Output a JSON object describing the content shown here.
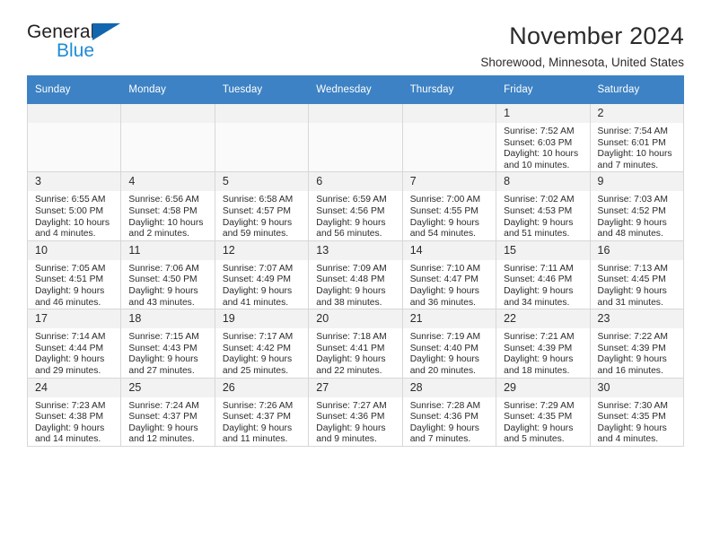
{
  "logo": {
    "word_top": "General",
    "word_bottom": "Blue",
    "triangle_color": "#1266ae",
    "blue_color": "#1f8bd6"
  },
  "header": {
    "title": "November 2024",
    "subtitle": "Shorewood, Minnesota, United States"
  },
  "theme": {
    "header_bg": "#3d82c4",
    "daynum_bg": "#f2f2f2",
    "grid_border": "#d7d7d7",
    "empty_cell_bg": "#fafafa"
  },
  "weekdays": [
    "Sunday",
    "Monday",
    "Tuesday",
    "Wednesday",
    "Thursday",
    "Friday",
    "Saturday"
  ],
  "labels": {
    "sunrise": "Sunrise:",
    "sunset": "Sunset:",
    "daylight": "Daylight:"
  },
  "weeks": [
    [
      {
        "day": "",
        "empty": true
      },
      {
        "day": "",
        "empty": true
      },
      {
        "day": "",
        "empty": true
      },
      {
        "day": "",
        "empty": true
      },
      {
        "day": "",
        "empty": true
      },
      {
        "day": "1",
        "sunrise": "Sunrise: 7:52 AM",
        "sunset": "Sunset: 6:03 PM",
        "daylight": "Daylight: 10 hours and 10 minutes."
      },
      {
        "day": "2",
        "sunrise": "Sunrise: 7:54 AM",
        "sunset": "Sunset: 6:01 PM",
        "daylight": "Daylight: 10 hours and 7 minutes."
      }
    ],
    [
      {
        "day": "3",
        "sunrise": "Sunrise: 6:55 AM",
        "sunset": "Sunset: 5:00 PM",
        "daylight": "Daylight: 10 hours and 4 minutes."
      },
      {
        "day": "4",
        "sunrise": "Sunrise: 6:56 AM",
        "sunset": "Sunset: 4:58 PM",
        "daylight": "Daylight: 10 hours and 2 minutes."
      },
      {
        "day": "5",
        "sunrise": "Sunrise: 6:58 AM",
        "sunset": "Sunset: 4:57 PM",
        "daylight": "Daylight: 9 hours and 59 minutes."
      },
      {
        "day": "6",
        "sunrise": "Sunrise: 6:59 AM",
        "sunset": "Sunset: 4:56 PM",
        "daylight": "Daylight: 9 hours and 56 minutes."
      },
      {
        "day": "7",
        "sunrise": "Sunrise: 7:00 AM",
        "sunset": "Sunset: 4:55 PM",
        "daylight": "Daylight: 9 hours and 54 minutes."
      },
      {
        "day": "8",
        "sunrise": "Sunrise: 7:02 AM",
        "sunset": "Sunset: 4:53 PM",
        "daylight": "Daylight: 9 hours and 51 minutes."
      },
      {
        "day": "9",
        "sunrise": "Sunrise: 7:03 AM",
        "sunset": "Sunset: 4:52 PM",
        "daylight": "Daylight: 9 hours and 48 minutes."
      }
    ],
    [
      {
        "day": "10",
        "sunrise": "Sunrise: 7:05 AM",
        "sunset": "Sunset: 4:51 PM",
        "daylight": "Daylight: 9 hours and 46 minutes."
      },
      {
        "day": "11",
        "sunrise": "Sunrise: 7:06 AM",
        "sunset": "Sunset: 4:50 PM",
        "daylight": "Daylight: 9 hours and 43 minutes."
      },
      {
        "day": "12",
        "sunrise": "Sunrise: 7:07 AM",
        "sunset": "Sunset: 4:49 PM",
        "daylight": "Daylight: 9 hours and 41 minutes."
      },
      {
        "day": "13",
        "sunrise": "Sunrise: 7:09 AM",
        "sunset": "Sunset: 4:48 PM",
        "daylight": "Daylight: 9 hours and 38 minutes."
      },
      {
        "day": "14",
        "sunrise": "Sunrise: 7:10 AM",
        "sunset": "Sunset: 4:47 PM",
        "daylight": "Daylight: 9 hours and 36 minutes."
      },
      {
        "day": "15",
        "sunrise": "Sunrise: 7:11 AM",
        "sunset": "Sunset: 4:46 PM",
        "daylight": "Daylight: 9 hours and 34 minutes."
      },
      {
        "day": "16",
        "sunrise": "Sunrise: 7:13 AM",
        "sunset": "Sunset: 4:45 PM",
        "daylight": "Daylight: 9 hours and 31 minutes."
      }
    ],
    [
      {
        "day": "17",
        "sunrise": "Sunrise: 7:14 AM",
        "sunset": "Sunset: 4:44 PM",
        "daylight": "Daylight: 9 hours and 29 minutes."
      },
      {
        "day": "18",
        "sunrise": "Sunrise: 7:15 AM",
        "sunset": "Sunset: 4:43 PM",
        "daylight": "Daylight: 9 hours and 27 minutes."
      },
      {
        "day": "19",
        "sunrise": "Sunrise: 7:17 AM",
        "sunset": "Sunset: 4:42 PM",
        "daylight": "Daylight: 9 hours and 25 minutes."
      },
      {
        "day": "20",
        "sunrise": "Sunrise: 7:18 AM",
        "sunset": "Sunset: 4:41 PM",
        "daylight": "Daylight: 9 hours and 22 minutes."
      },
      {
        "day": "21",
        "sunrise": "Sunrise: 7:19 AM",
        "sunset": "Sunset: 4:40 PM",
        "daylight": "Daylight: 9 hours and 20 minutes."
      },
      {
        "day": "22",
        "sunrise": "Sunrise: 7:21 AM",
        "sunset": "Sunset: 4:39 PM",
        "daylight": "Daylight: 9 hours and 18 minutes."
      },
      {
        "day": "23",
        "sunrise": "Sunrise: 7:22 AM",
        "sunset": "Sunset: 4:39 PM",
        "daylight": "Daylight: 9 hours and 16 minutes."
      }
    ],
    [
      {
        "day": "24",
        "sunrise": "Sunrise: 7:23 AM",
        "sunset": "Sunset: 4:38 PM",
        "daylight": "Daylight: 9 hours and 14 minutes."
      },
      {
        "day": "25",
        "sunrise": "Sunrise: 7:24 AM",
        "sunset": "Sunset: 4:37 PM",
        "daylight": "Daylight: 9 hours and 12 minutes."
      },
      {
        "day": "26",
        "sunrise": "Sunrise: 7:26 AM",
        "sunset": "Sunset: 4:37 PM",
        "daylight": "Daylight: 9 hours and 11 minutes."
      },
      {
        "day": "27",
        "sunrise": "Sunrise: 7:27 AM",
        "sunset": "Sunset: 4:36 PM",
        "daylight": "Daylight: 9 hours and 9 minutes."
      },
      {
        "day": "28",
        "sunrise": "Sunrise: 7:28 AM",
        "sunset": "Sunset: 4:36 PM",
        "daylight": "Daylight: 9 hours and 7 minutes."
      },
      {
        "day": "29",
        "sunrise": "Sunrise: 7:29 AM",
        "sunset": "Sunset: 4:35 PM",
        "daylight": "Daylight: 9 hours and 5 minutes."
      },
      {
        "day": "30",
        "sunrise": "Sunrise: 7:30 AM",
        "sunset": "Sunset: 4:35 PM",
        "daylight": "Daylight: 9 hours and 4 minutes."
      }
    ]
  ]
}
